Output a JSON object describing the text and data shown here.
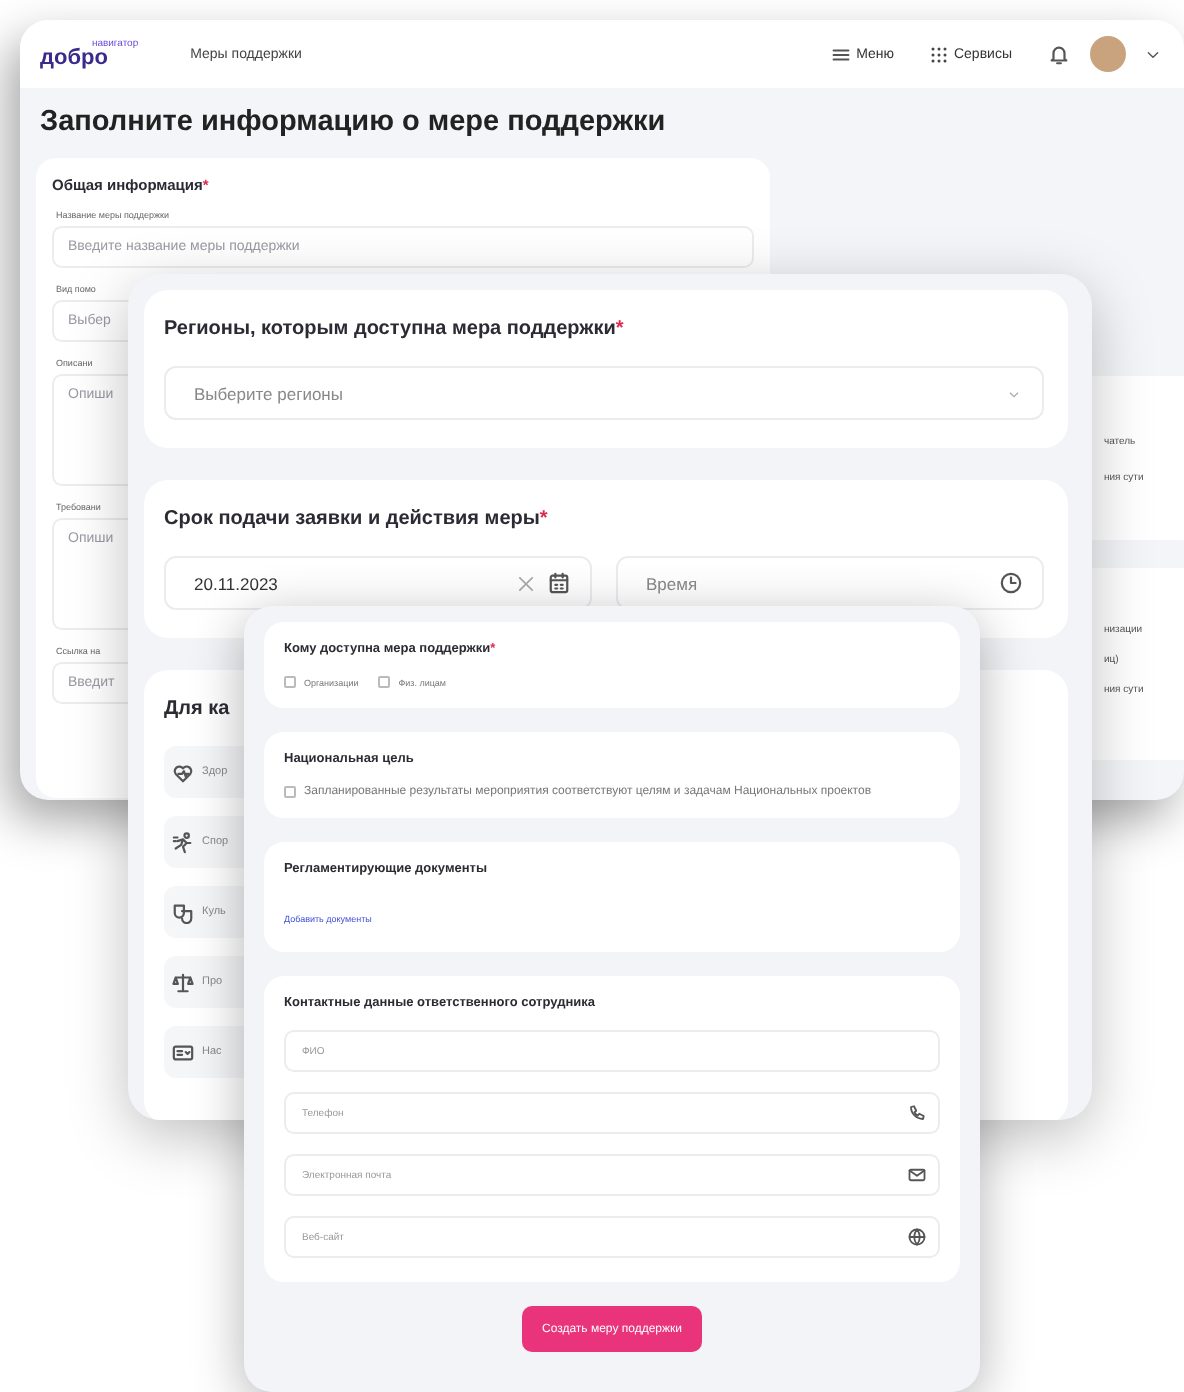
{
  "back_window": {
    "logo": {
      "text": "добро",
      "tagline": "навигатор"
    },
    "nav_title": "Меры поддержки",
    "menu_label": "Меню",
    "services_label": "Сервисы",
    "page_title": "Заполните информацию о мере поддержки",
    "general_card": {
      "title": "Общая информация",
      "required_mark": "*",
      "fields": [
        {
          "kind": "input",
          "label": "Название меры поддержки",
          "placeholder": "Введите название меры поддержки"
        },
        {
          "kind": "input",
          "label": "Вид помо",
          "placeholder": "Выбер"
        },
        {
          "kind": "textarea",
          "label": "Описани",
          "placeholder": "Опиши"
        },
        {
          "kind": "textarea",
          "label": "Требовани",
          "placeholder": "Опиши"
        },
        {
          "kind": "input",
          "label": "Ссылка на",
          "placeholder": "Введит"
        }
      ]
    },
    "side_cards": [
      {
        "lines": [
          "чатель",
          "ния сути"
        ]
      },
      {
        "lines": [
          "низации",
          "иц)",
          "ния сути"
        ]
      }
    ]
  },
  "middle_window": {
    "regions_card": {
      "title": "Регионы, которым доступна мера поддержки",
      "required_mark": "*",
      "placeholder": "Выберите регионы"
    },
    "deadline_card": {
      "title": "Срок подачи заявки и действия меры",
      "required_mark": "*",
      "date_value": "20.11.2023",
      "time_placeholder": "Время"
    },
    "directions_card": {
      "title": "Для ка",
      "items": [
        {
          "kind": "health",
          "label": "Здор"
        },
        {
          "kind": "sport",
          "label": "Спор"
        },
        {
          "kind": "culture",
          "label": "Куль"
        },
        {
          "kind": "law",
          "label": "Про"
        },
        {
          "kind": "science",
          "label": "Нас"
        }
      ]
    }
  },
  "front_window": {
    "audience_card": {
      "title": "Кому доступна мера поддержки",
      "required_mark": "*",
      "options": [
        {
          "label": "Организации",
          "checked": false
        },
        {
          "label": "Физ. лицам",
          "checked": false
        }
      ]
    },
    "goal_card": {
      "title": "Национальная цель",
      "option": {
        "label": "Запланированные результаты мероприятия соответствуют целям и задачам Национальных проектов",
        "checked": false
      }
    },
    "docs_card": {
      "title": "Регламентирующие документы",
      "link": "Добавить документы"
    },
    "contacts_card": {
      "title": "Контактные данные ответственного сотрудника",
      "fields": [
        {
          "kind": "name",
          "placeholder": "ФИО"
        },
        {
          "kind": "phone",
          "placeholder": "Телефон"
        },
        {
          "kind": "email",
          "placeholder": "Электронная почта"
        },
        {
          "kind": "website",
          "placeholder": "Веб-сайт"
        }
      ]
    },
    "submit_button": "Создать меру поддержки"
  }
}
